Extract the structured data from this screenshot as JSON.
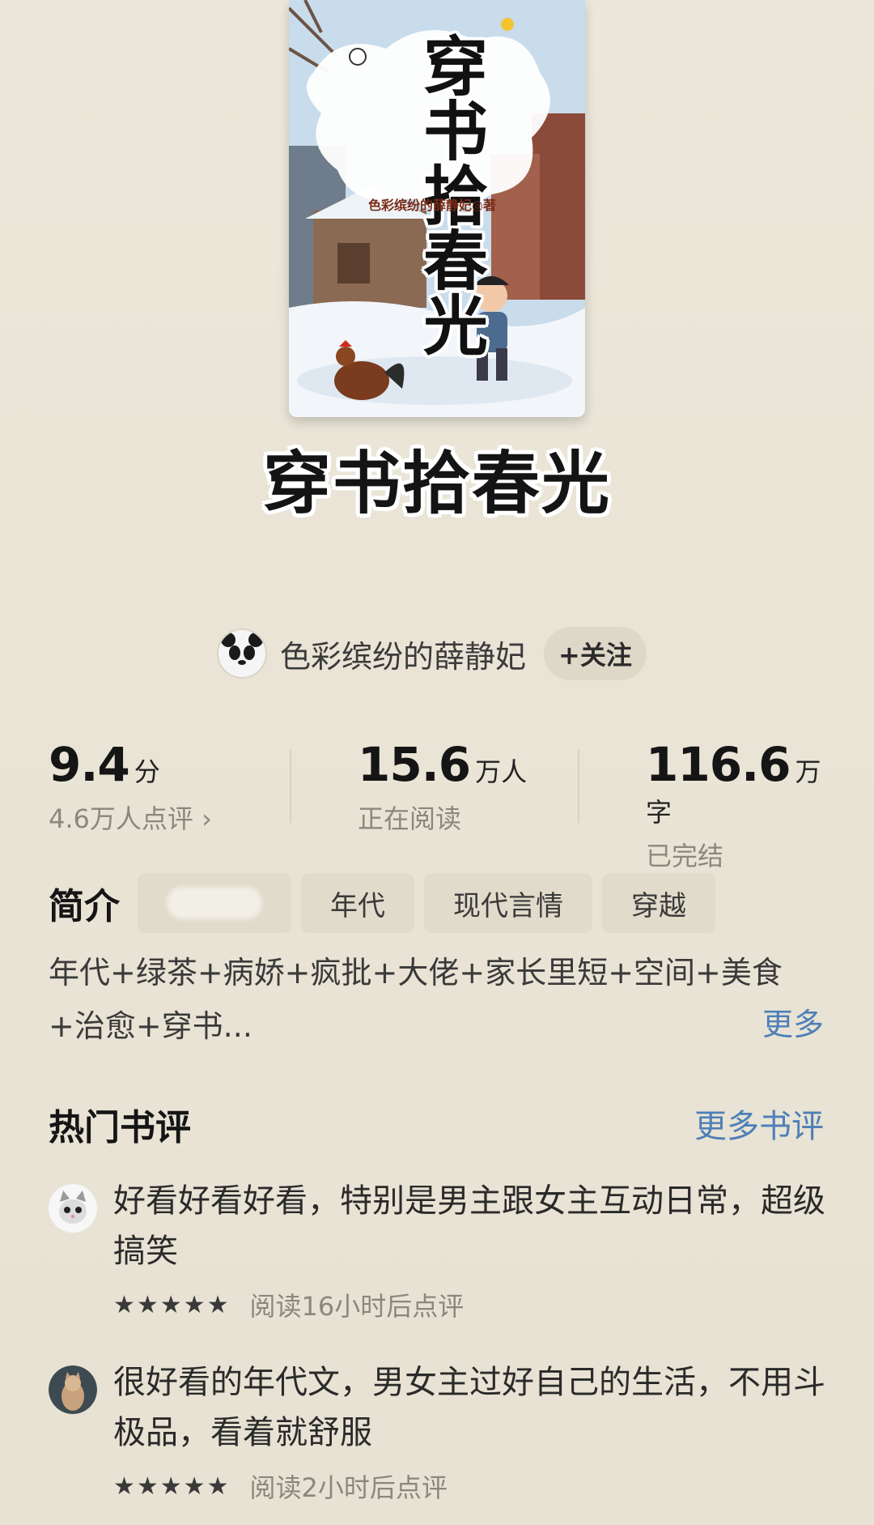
{
  "book": {
    "title": "穿书拾春光",
    "cover_title": "穿书拾春光",
    "cover_author": "色彩缤纷的薛静妃◎著"
  },
  "author": {
    "name": "色彩缤纷的薛静妃",
    "follow_label": "+关注",
    "avatar_icon": "panda-avatar-icon"
  },
  "stats": {
    "rating": {
      "value": "9.4",
      "unit": "分",
      "sub": "4.6万人点评 ›"
    },
    "readers": {
      "value": "15.6",
      "unit": "万人",
      "sub": "正在阅读"
    },
    "words": {
      "value": "116.6",
      "unit": "万字",
      "sub": "已完结"
    }
  },
  "intro": {
    "label": "简介",
    "tags": [
      "年代",
      "现代言情",
      "穿越"
    ],
    "text": "年代+绿茶+病娇+疯批+大佬+家长里短+空间+美食+治愈+穿书...",
    "more_label": "更多"
  },
  "reviews": {
    "title": "热门书评",
    "more_label": "更多书评",
    "items": [
      {
        "text": "好看好看好看，特别是男主跟女主互动日常，超级搞笑",
        "stars": "★★★★★",
        "time": "阅读16小时后点评",
        "avatar_icon": "cat-avatar-icon"
      },
      {
        "text": "很好看的年代文，男女主过好自己的生活，不用斗极品，看着就舒服",
        "stars": "★★★★★",
        "time": "阅读2小时后点评",
        "avatar_icon": "cat-photo-avatar-icon"
      }
    ]
  },
  "colors": {
    "background": "#e9e4d7",
    "link": "#4d7fb8",
    "tag_bg": "#e1dbcb"
  }
}
